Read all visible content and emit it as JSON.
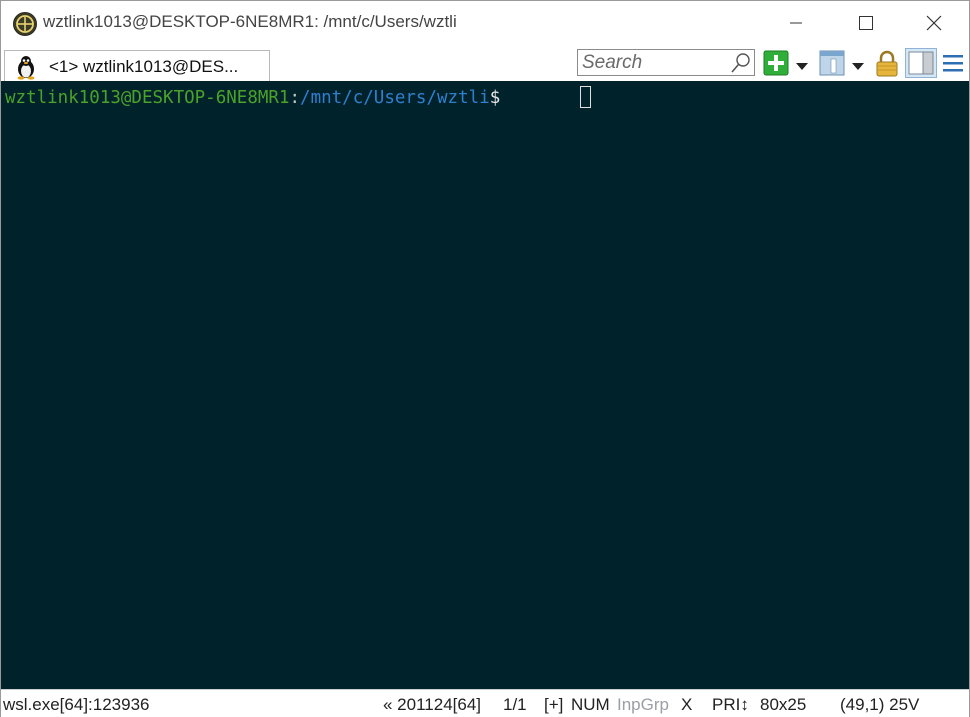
{
  "window": {
    "title": "wztlink1013@DESKTOP-6NE8MR1: /mnt/c/Users/wztli"
  },
  "tabs": [
    {
      "label": "<1> wztlink1013@DES..."
    }
  ],
  "toolbar": {
    "search_placeholder": "Search"
  },
  "terminal": {
    "prompt_user": "wztlink1013@DESKTOP-6NE8MR1",
    "prompt_colon": ":",
    "prompt_path": "/mnt/c/Users/wztli",
    "prompt_symbol": "$ ",
    "colors": {
      "background": "#00222b",
      "user": "#4aa22a",
      "path": "#2f7fcf"
    }
  },
  "statusbar": {
    "process": "wsl.exe[64]:123936",
    "build": "« 201124[64]",
    "tab_index": "1/1",
    "plus": "[+]",
    "num": "NUM",
    "inpgrp": "InpGrp",
    "x": "X",
    "pri": "PRI↕",
    "size": "80x25",
    "position": "(49,1) 25V"
  }
}
